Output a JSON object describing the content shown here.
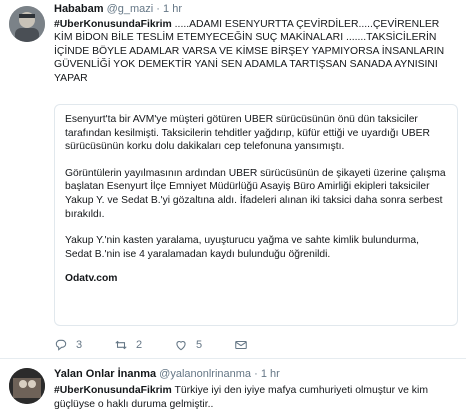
{
  "tweet1": {
    "name": "Hababam",
    "handle": "@g_mazi",
    "dot": "·",
    "time": "1 hr",
    "hashtag": "#UberKonusundaFikrim",
    "text": " .....ADAMI ESENYURTTA ÇEVİRDİLER.....ÇEVİRENLER KİM BİDON BİLE TESLİM ETEMYECEĞİN SUÇ MAKİNALARI .......TAKSİCİLERİN İÇİNDE BÖYLE ADAMLAR VARSA VE KİMSE BİRŞEY YAPMIYORSA İNSANLARIN GÜVENLİĞİ YOK DEMEKTİR YANİ SEN ADAMLA TARTIŞSAN SANADA AYNISINI YAPAR",
    "card": {
      "p1": "Esenyurt'ta bir AVM'ye müşteri götüren UBER sürücüsünün önü dün taksiciler tarafından kesilmişti. Taksicilerin tehditler yağdırıp, küfür ettiği ve uyardığı UBER sürücüsünün korku dolu dakikaları cep telefonuna yansımıştı.",
      "p2": "Görüntülerin yayılmasının ardından UBER sürücüsünün de şikayeti üzerine çalışma başlatan Esenyurt İlçe Emniyet Müdürlüğü Asayiş Büro Amirliği ekipleri taksiciler Yakup Y. ve Sedat B.'yi gözaltına aldı. İfadeleri alınan iki taksici daha sonra serbest bırakıldı.",
      "p3": "Yakup Y.'nin kasten yaralama, uyuşturucu yağma ve sahte kimlik bulundurma, Sedat B.'nin ise 4 yaralamadan kaydı bulunduğu öğrenildi.",
      "source": "Odatv.com"
    },
    "actions": {
      "replies": "3",
      "retweets": "2",
      "likes": "5"
    }
  },
  "tweet2": {
    "name": "Yalan Onlar İnanma",
    "handle": "@yalanonlrinanma",
    "dot": "·",
    "time": "1 hr",
    "hashtag": "#UberKonusundaFikrim",
    "text": " Türkiye iyi den iyiye mafya cumhuriyeti olmuştur ve kim güçlüyse o haklı duruma gelmiştir.."
  },
  "colors": {
    "text": "#14171a",
    "muted": "#657786",
    "border": "#e1e8ed"
  },
  "icons": [
    "reply-icon",
    "retweet-icon",
    "like-icon",
    "message-icon"
  ]
}
